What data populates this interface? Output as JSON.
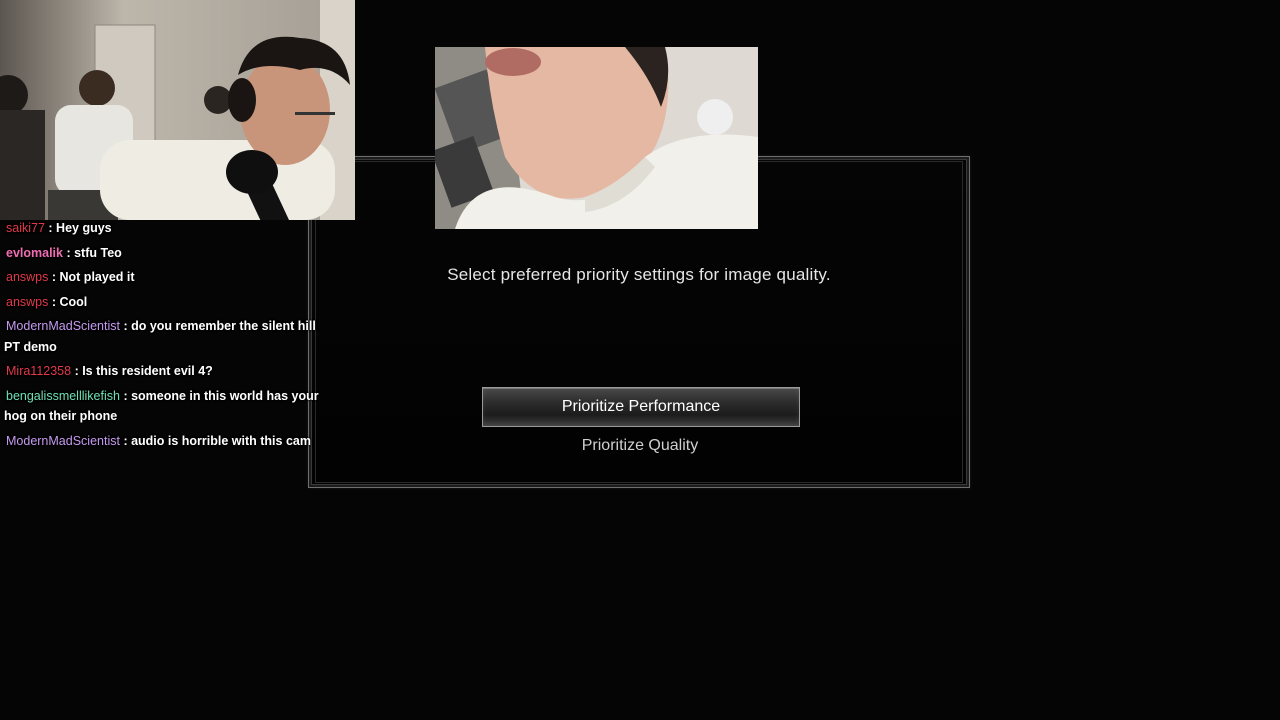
{
  "game": {
    "dialog": {
      "prompt": "Select preferred priority settings for image quality.",
      "options": [
        {
          "label": "Prioritize Performance",
          "selected": true
        },
        {
          "label": "Prioritize Quality",
          "selected": false
        }
      ]
    }
  },
  "webcams": {
    "main_feed": "streamer webcam",
    "secondary_feed": "close-up phone camera"
  },
  "chat": {
    "messages": [
      {
        "user": "saiki77",
        "color": "#e03a4a",
        "text": ": Hey guys"
      },
      {
        "user": "evlomalik",
        "color": "#f06db3",
        "text": ": stfu Teo"
      },
      {
        "user": "answps",
        "color": "#e03a4a",
        "text": ": Not played it"
      },
      {
        "user": "answps",
        "color": "#e03a4a",
        "text": ": Cool"
      },
      {
        "user": "ModernMadScientist",
        "color": "#c59af0",
        "text": ": do you remember the silent hill PT demo"
      },
      {
        "user": "Mira112358",
        "color": "#e03a4a",
        "text": ": Is this resident evil 4?"
      },
      {
        "user": "bengalissmelllikefish",
        "color": "#6fe0b8",
        "text": ": someone in this world has your hog on their phone"
      },
      {
        "user": "ModernMadScientist",
        "color": "#c59af0",
        "text": ": audio is horrible with this cam"
      }
    ]
  }
}
